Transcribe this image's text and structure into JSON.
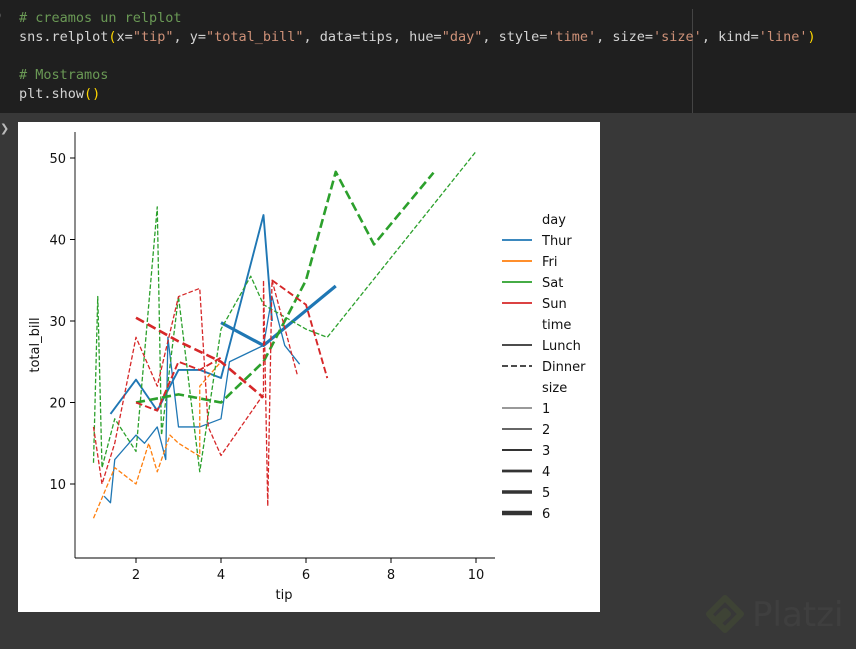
{
  "code_cell": {
    "line1": "# creamos un relplot",
    "line2_parts": [
      "sns.relplot",
      "(",
      "x=",
      "\"tip\"",
      ", y=",
      "\"total_bill\"",
      ", data=tips, hue=",
      "\"day\"",
      ", style=",
      "'time'",
      ", size=",
      "'size'",
      ", kind=",
      "'line'",
      ")"
    ],
    "line4": "# Mostramos",
    "line5_parts": [
      "plt.show",
      "()"
    ]
  },
  "watermark": "Platzi",
  "colors": {
    "Thur": "#1f77b4",
    "Fri": "#ff7f0e",
    "Sat": "#2ca02c",
    "Sun": "#d62728",
    "bg": "#383838",
    "code_bg": "#1f1f1f"
  },
  "chart_data": {
    "type": "line",
    "xlabel": "tip",
    "ylabel": "total_bill",
    "xlim": [
      0.5,
      10.4
    ],
    "ylim": [
      1,
      53
    ],
    "xticks": [
      "2",
      "4",
      "6",
      "8",
      "10"
    ],
    "yticks": [
      "10",
      "20",
      "30",
      "40",
      "50"
    ],
    "legend": {
      "placement": "right",
      "day_title": "day",
      "days": [
        "Thur",
        "Fri",
        "Sat",
        "Sun"
      ],
      "time_title": "time",
      "times": [
        "Lunch",
        "Dinner"
      ],
      "size_title": "size",
      "sizes": [
        "1",
        "2",
        "3",
        "4",
        "5",
        "6"
      ]
    },
    "series": [
      {
        "day": "Thur",
        "time": "Lunch",
        "size": 2,
        "x": [
          1.25,
          1.4,
          1.5,
          2,
          2.2,
          2.5,
          2.7,
          2.75,
          3,
          3.5,
          4,
          4.2,
          5,
          5.2,
          5.5,
          5.85
        ],
        "y": [
          8.5,
          7.7,
          13,
          16,
          15,
          17,
          13,
          28,
          17,
          17,
          18,
          25,
          27,
          33,
          27,
          24.7
        ]
      },
      {
        "day": "Thur",
        "time": "Lunch",
        "size": 3,
        "x": [
          1.4,
          2,
          2.5,
          3,
          3.5,
          4,
          5,
          5.2
        ],
        "y": [
          18.6,
          22.8,
          19,
          24,
          24,
          23,
          43,
          30
        ]
      },
      {
        "day": "Thur",
        "time": "Lunch",
        "size": 5,
        "x": [
          4,
          5,
          6.7
        ],
        "y": [
          29.8,
          27,
          34.3
        ]
      },
      {
        "day": "Fri",
        "time": "Dinner",
        "size": 2,
        "x": [
          1,
          1.5,
          2,
          2.3,
          2.5,
          2.8,
          3,
          3.5,
          3.5,
          4
        ],
        "y": [
          5.8,
          12,
          10,
          15,
          11.5,
          16,
          15,
          13.4,
          22,
          25
        ]
      },
      {
        "day": "Sat",
        "time": "Dinner",
        "size": 2,
        "x": [
          1,
          1.1,
          1.2,
          1.5,
          2,
          2.5,
          2.6,
          3,
          3.3,
          3.5,
          4,
          4.7,
          5,
          6,
          6.5,
          10
        ],
        "y": [
          12.6,
          33,
          12,
          18,
          14,
          44,
          16,
          33,
          20,
          11.5,
          29,
          35.5,
          32,
          29,
          28,
          50.8
        ]
      },
      {
        "day": "Sat",
        "time": "Dinner",
        "size": 4,
        "x": [
          2,
          3,
          4,
          5,
          6,
          6.7,
          7.6,
          9
        ],
        "y": [
          20,
          21,
          20,
          25,
          35,
          48.3,
          39.4,
          48.2
        ]
      },
      {
        "day": "Sun",
        "time": "Dinner",
        "size": 2,
        "x": [
          1,
          1.2,
          1.5,
          2,
          2.5,
          3,
          3.5,
          3.7,
          4,
          5,
          5,
          5.1,
          5.2,
          5.8
        ],
        "y": [
          17,
          10,
          15,
          28,
          22,
          33,
          34,
          17,
          13.5,
          21,
          35,
          7.3,
          35,
          23.3
        ]
      },
      {
        "day": "Sun",
        "time": "Dinner",
        "size": 3,
        "x": [
          2,
          2.5,
          3,
          3.5,
          4
        ],
        "y": [
          20,
          19,
          25,
          24,
          25.5
        ]
      },
      {
        "day": "Sun",
        "time": "Dinner",
        "size": 4,
        "x": [
          2,
          3,
          4,
          5
        ],
        "y": [
          30.4,
          27.5,
          25,
          20.6
        ]
      },
      {
        "day": "Sun",
        "time": "Dinner",
        "size": 3,
        "x": [
          5.2,
          6,
          6.5
        ],
        "y": [
          35,
          32,
          23
        ]
      }
    ]
  }
}
